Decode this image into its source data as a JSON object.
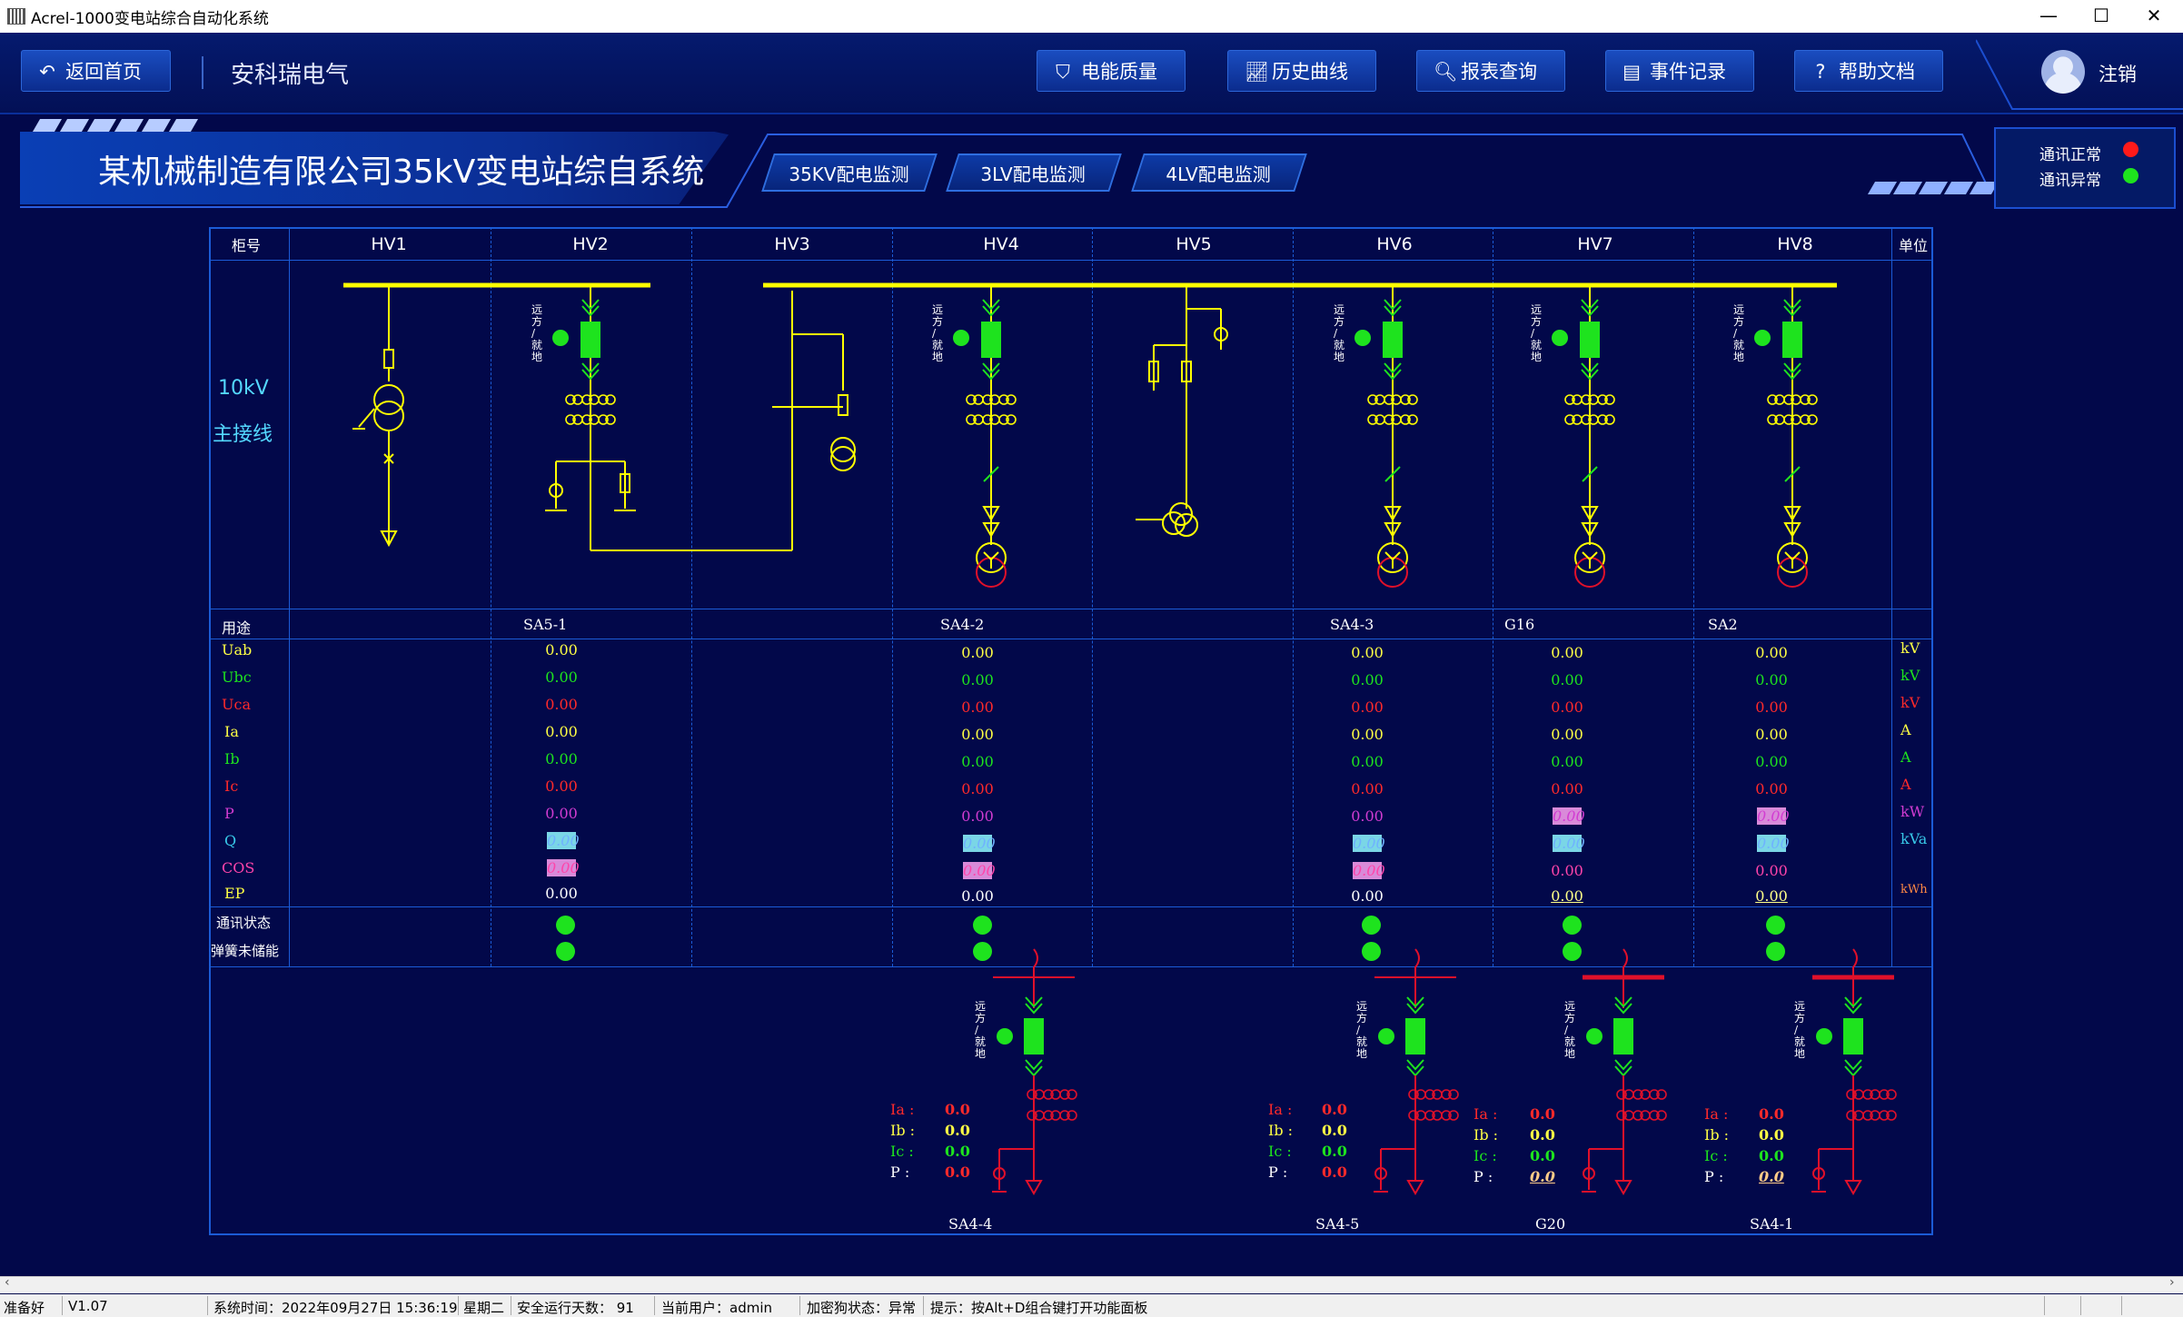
{
  "window": {
    "title": "Acrel-1000变电站综合自动化系统",
    "min": "—",
    "max": "☐",
    "close": "✕"
  },
  "nav": {
    "back": "返回首页",
    "company": "安科瑞电气",
    "buttons": [
      "电能质量",
      "历史曲线",
      "报表查询",
      "事件记录",
      "帮助文档"
    ],
    "logout": "注销"
  },
  "banner": {
    "title": "某机械制造有限公司35kV变电站综自系统",
    "tabs": [
      "35KV配电监测",
      "3LV配电监测",
      "4LV配电监测"
    ]
  },
  "comm_legend": {
    "normal": "通讯正常",
    "abnormal": "通讯异常",
    "normal_color": "#ff1a1a",
    "abnormal_color": "#1ee31e"
  },
  "table": {
    "cabinet_label": "柜号",
    "unit_label": "单位",
    "cabinets": [
      "HV1",
      "HV2",
      "HV3",
      "HV4",
      "HV5",
      "HV6",
      "HV7",
      "HV8"
    ],
    "voltage_label": "10kV",
    "main_wiring": "主接线",
    "usage_label": "用途",
    "usages": {
      "HV2": "SA5-1",
      "HV4": "SA4-2",
      "HV6": "SA4-3",
      "HV7": "G16",
      "HV8": "SA2"
    },
    "params": [
      "Uab",
      "Ubc",
      "Uca",
      "Ia",
      "Ib",
      "Ic",
      "P",
      "Q",
      "COS",
      "EP"
    ],
    "units": [
      "kV",
      "kV",
      "kV",
      "A",
      "A",
      "A",
      "kW",
      "kVa",
      "",
      "kWh"
    ],
    "values": {
      "HV2": [
        "0.00",
        "0.00",
        "0.00",
        "0.00",
        "0.00",
        "0.00",
        "0.00",
        "0.00",
        "0.00",
        "0.00"
      ],
      "HV4": [
        "0.00",
        "0.00",
        "0.00",
        "0.00",
        "0.00",
        "0.00",
        "0.00",
        "0.00",
        "0.00",
        "0.00"
      ],
      "HV6": [
        "0.00",
        "0.00",
        "0.00",
        "0.00",
        "0.00",
        "0.00",
        "0.00",
        "0.00",
        "0.00",
        "0.00"
      ],
      "HV7": [
        "0.00",
        "0.00",
        "0.00",
        "0.00",
        "0.00",
        "0.00",
        "0.00",
        "0.00",
        "0.00",
        "0.00"
      ],
      "HV8": [
        "0.00",
        "0.00",
        "0.00",
        "0.00",
        "0.00",
        "0.00",
        "0.00",
        "0.00",
        "0.00",
        "0.00"
      ]
    },
    "comm_status_label": "通讯状态",
    "spring_label": "弹簧未储能",
    "switch_label": [
      "远",
      "方",
      "/",
      "就",
      "地"
    ]
  },
  "feeders": [
    {
      "name": "SA4-4",
      "ia": "0.0",
      "ib": "0.0",
      "ic": "0.0",
      "p": "0.0"
    },
    {
      "name": "SA4-5",
      "ia": "0.0",
      "ib": "0.0",
      "ic": "0.0",
      "p": "0.0"
    },
    {
      "name": "G20",
      "ia": "0.0",
      "ib": "0.0",
      "ic": "0.0",
      "p": "0.0"
    },
    {
      "name": "SA4-1",
      "ia": "0.0",
      "ib": "0.0",
      "ic": "0.0",
      "p": "0.0"
    }
  ],
  "feeder_labels": {
    "ia": "Ia :",
    "ib": "Ib :",
    "ic": "Ic :",
    "p": "P :"
  },
  "statusbar": {
    "ready": "准备好",
    "version": "V1.07",
    "time": "系统时间：2022年09月27日  15:36:19",
    "weekday": "星期二",
    "safe_days": "安全运行天数：  91",
    "user": "当前用户：admin",
    "dongle": "加密狗状态：异常",
    "hint": "提示：按Alt+D组合键打开功能面板"
  },
  "colors": {
    "bus": "#ffff00",
    "breaker": "#1ee31e",
    "feeder": "#e0102a",
    "grid": "#1b5bd6"
  }
}
